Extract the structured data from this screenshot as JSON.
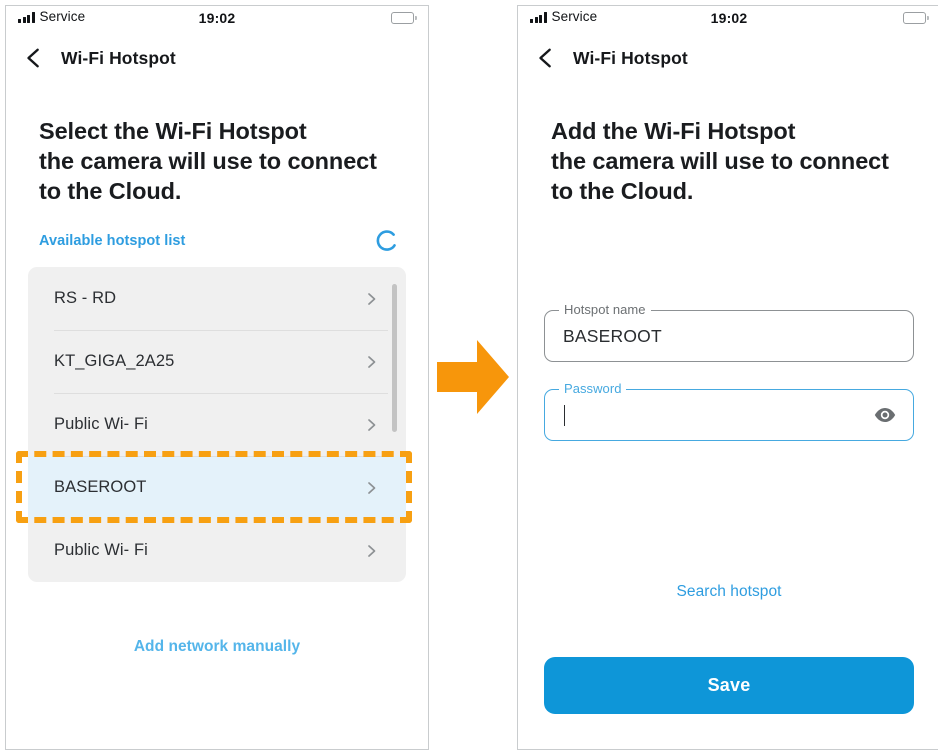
{
  "statusbar": {
    "carrier": "Service",
    "time": "19:02",
    "signal_icon": "signal-bars-icon",
    "battery_icon": "battery-full-icon"
  },
  "left_screen": {
    "nav": {
      "back_icon": "back-chevron-icon",
      "title": "Wi-Fi Hotspot"
    },
    "heading": "Select the Wi-Fi Hotspot the camera will use to connect to the Cloud.",
    "heading_lines": [
      "Select the Wi-Fi Hotspot",
      "the camera will use to connect",
      "to the Cloud."
    ],
    "list_label": "Available hotspot list",
    "spinner_icon": "loading-spinner-icon",
    "hotspots": [
      {
        "name": "RS - RD",
        "selected": false
      },
      {
        "name": "KT_GIGA_2A25",
        "selected": false
      },
      {
        "name": "Public Wi- Fi",
        "selected": false
      },
      {
        "name": "BASEROOT",
        "selected": true
      },
      {
        "name": "Public Wi- Fi",
        "selected": false
      }
    ],
    "row_chevron_icon": "chevron-right-icon",
    "manual_link": "Add network manually"
  },
  "arrow": {
    "icon": "right-arrow-icon",
    "color": "#F7960B"
  },
  "right_screen": {
    "nav": {
      "back_icon": "back-chevron-icon",
      "title": "Wi-Fi Hotspot"
    },
    "heading_lines": [
      "Add the Wi-Fi Hotspot",
      "the camera will use to connect",
      "to the Cloud."
    ],
    "hotspot_name_field": {
      "label": "Hotspot name",
      "value": "BASEROOT",
      "focused": false
    },
    "password_field": {
      "label": "Password",
      "value": "",
      "placeholder": "",
      "focused": true,
      "reveal_icon": "eye-icon"
    },
    "search_link": "Search hotspot",
    "save_button": "Save"
  },
  "colors": {
    "accent_blue": "#0E96D8",
    "link_blue": "#2e9de0",
    "light_link_blue": "#54b5ea",
    "highlight_row": "#e4f2fa",
    "dashed_orange": "#F7A012",
    "arrow_orange": "#F7960B"
  }
}
